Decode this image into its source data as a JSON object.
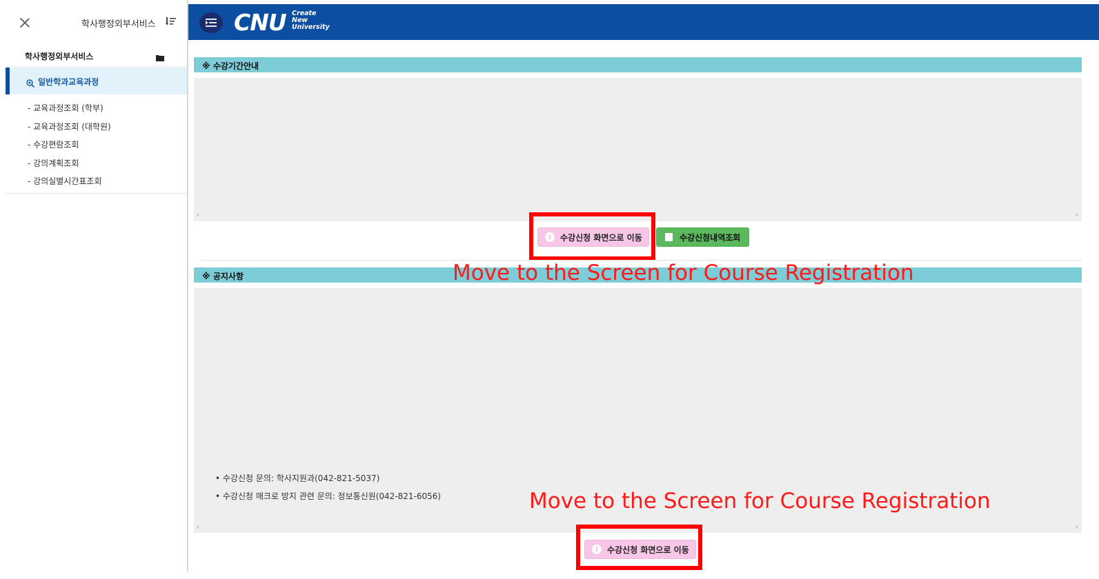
{
  "sidebar": {
    "title": "학사행정외부서비스",
    "section_label": "학사행정외부서비스",
    "active_item": "일반학과교육과정",
    "sub_items": [
      "- 교육과정조회 (학부)",
      "- 교육과정조회 (대학원)",
      "- 수강편람조회",
      "- 강의계획조회",
      "- 강의실별시간표조회"
    ]
  },
  "header": {
    "logo_main": "CNU",
    "logo_sub_1": "Create",
    "logo_sub_2": "New",
    "logo_sub_3": "University",
    "color": "#0c4ea2"
  },
  "section1": {
    "title": "※ 수강기간안내",
    "register_button": "수강신청 화면으로 이동",
    "history_button": "수강신청내역조회"
  },
  "section2": {
    "title": "※ 공지사항",
    "notices": [
      "• 수강신청 문의: 학사지원과(042-821-5037)",
      "• 수강신청 매크로 방지 관련 문의: 정보통신원(042-821-6056)"
    ],
    "register_button": "수강신청 화면으로 이동"
  },
  "annotations": {
    "caption_1": "Move to the Screen for Course Registration",
    "caption_2": "Move to the Screen for Course Registration",
    "highlight_color": "#ff0000"
  },
  "icons": [
    "close-icon",
    "sort-icon",
    "folder-icon",
    "zoom-in-icon",
    "menu-icon",
    "info-icon",
    "book-icon"
  ]
}
